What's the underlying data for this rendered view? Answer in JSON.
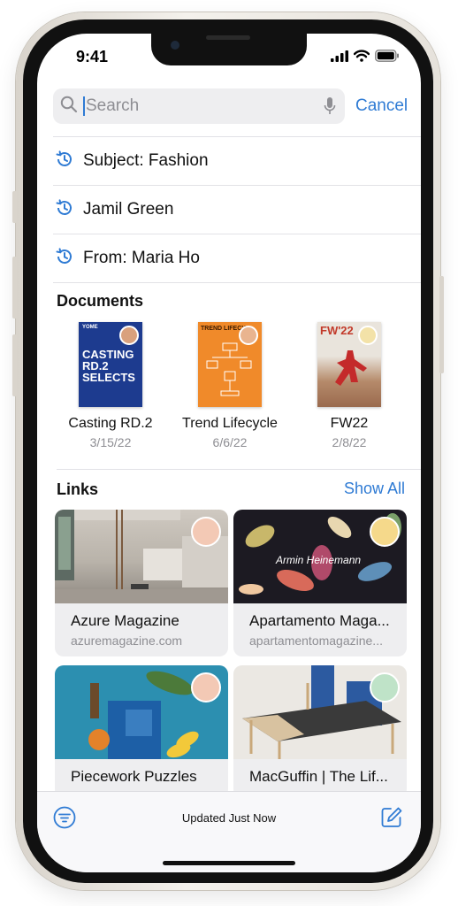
{
  "status_bar": {
    "time": "9:41"
  },
  "search": {
    "placeholder": "Search",
    "value": "",
    "cancel_label": "Cancel"
  },
  "recent_searches": [
    {
      "label": "Subject: Fashion"
    },
    {
      "label": "Jamil Green"
    },
    {
      "label": "From: Maria Ho"
    }
  ],
  "documents": {
    "title": "Documents",
    "items": [
      {
        "name": "Casting RD.2",
        "date": "3/15/22",
        "cover_text": "CASTING RD.2 SELECTS",
        "cover_color": "#1d3b8f",
        "cover_small": "YOME"
      },
      {
        "name": "Trend Lifecycle",
        "date": "6/6/22",
        "cover_text": "TREND LIFECYCLE",
        "cover_color": "#f08a2a"
      },
      {
        "name": "FW22",
        "date": "2/8/22",
        "cover_text": "FW'22",
        "cover_color": "#c23a2a"
      }
    ]
  },
  "links": {
    "title": "Links",
    "show_all_label": "Show All",
    "items": [
      {
        "title": "Azure Magazine",
        "url": "azuremagazine.com",
        "avatar_color": "#f3c9b5"
      },
      {
        "title": "Apartamento Maga...",
        "url": "apartamentomagazine...",
        "image_caption": "Armin Heinemann",
        "avatar_color": "#f5d98b"
      },
      {
        "title": "Piecework Puzzles",
        "url": "",
        "avatar_color": "#f3c9b5"
      },
      {
        "title": "MacGuffin | The Lif...",
        "url": "",
        "avatar_color": "#bfe3c8"
      }
    ]
  },
  "bottom_bar": {
    "status": "Updated Just Now"
  },
  "colors": {
    "accent": "#2f7bd4"
  }
}
